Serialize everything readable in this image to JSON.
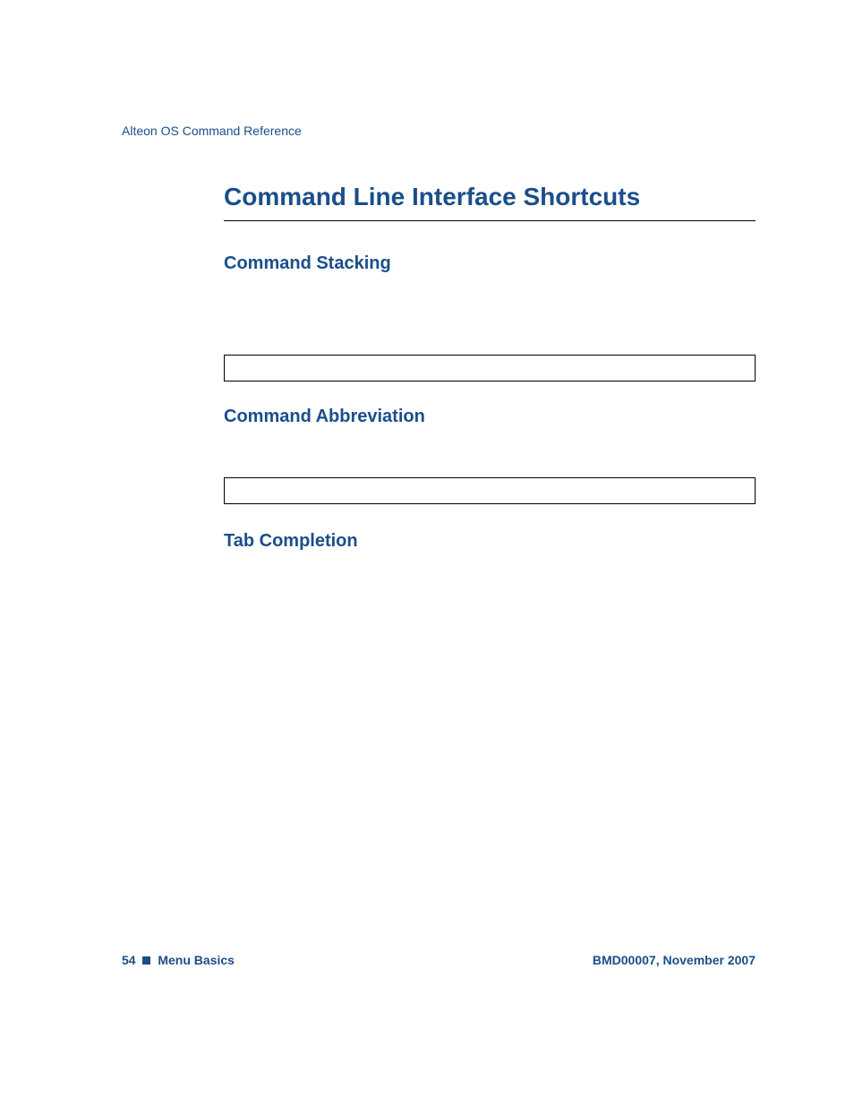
{
  "header": {
    "doc_title": "Alteon OS Command Reference"
  },
  "main": {
    "title": "Command Line Interface Shortcuts",
    "sections": [
      {
        "heading": "Command Stacking"
      },
      {
        "heading": "Command Abbreviation"
      },
      {
        "heading": "Tab Completion"
      }
    ]
  },
  "footer": {
    "page_num": "54",
    "chapter": "Menu Basics",
    "doc_id": "BMD00007, November 2007"
  }
}
